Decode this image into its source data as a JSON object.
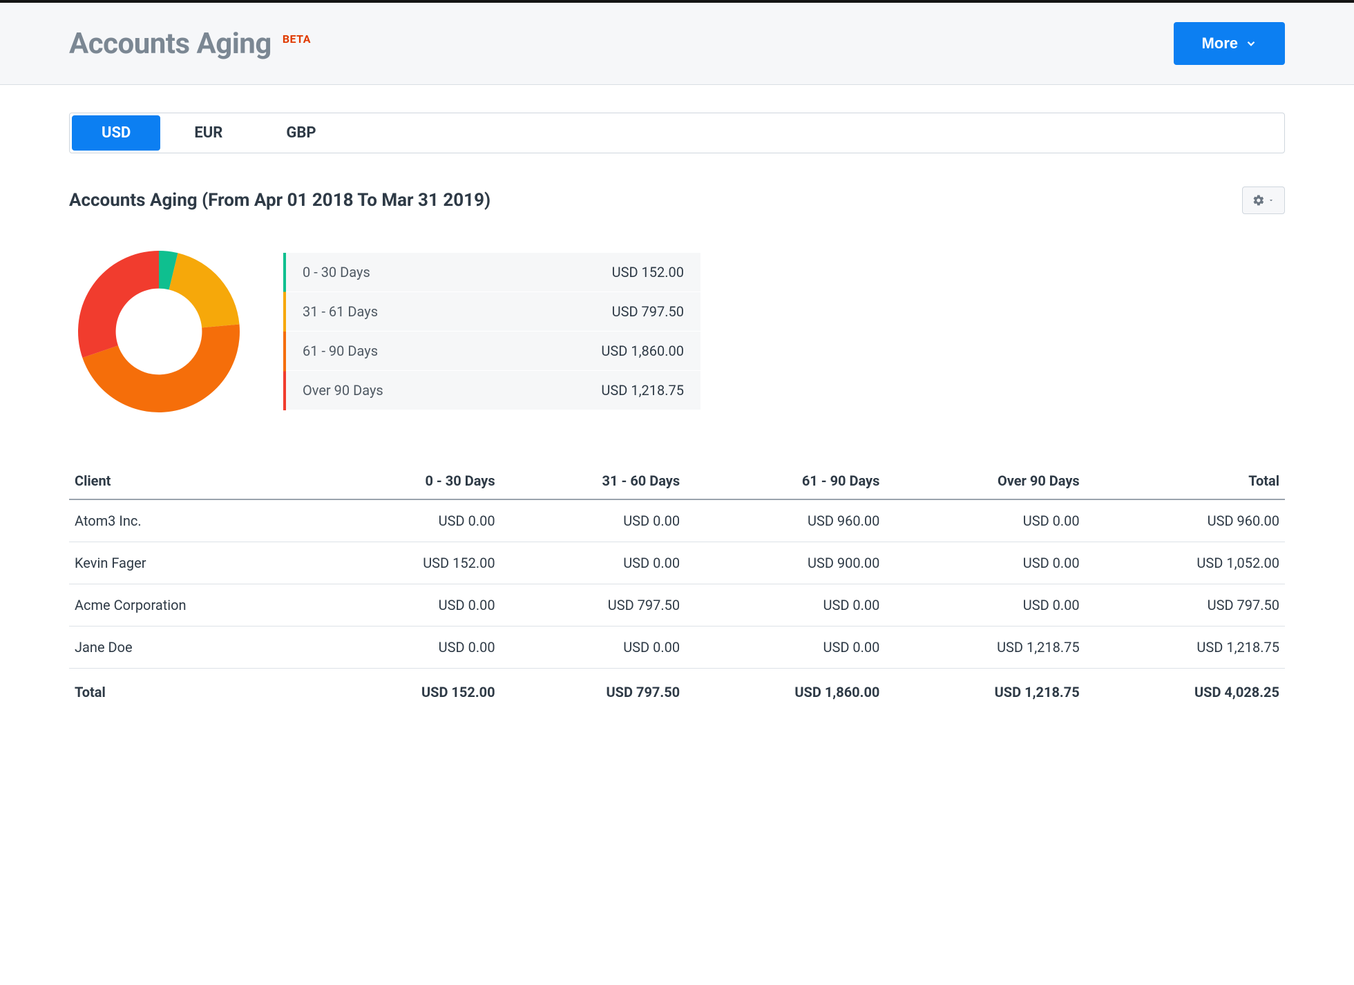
{
  "header": {
    "title": "Accounts Aging",
    "badge": "BETA",
    "more_label": "More"
  },
  "tabs": [
    {
      "label": "USD",
      "active": true
    },
    {
      "label": "EUR",
      "active": false
    },
    {
      "label": "GBP",
      "active": false
    }
  ],
  "report": {
    "title": "Accounts Aging (From Apr 01 2018 To Mar 31 2019)"
  },
  "chart_data": {
    "type": "pie",
    "title": "Accounts Aging",
    "series": [
      {
        "name": "0 - 30 Days",
        "value": 152.0,
        "value_label": "USD 152.00",
        "color": "#0fbf8f"
      },
      {
        "name": "31 - 61 Days",
        "value": 797.5,
        "value_label": "USD 797.50",
        "color": "#f6a80a"
      },
      {
        "name": "61 - 90 Days",
        "value": 1860.0,
        "value_label": "USD 1,860.00",
        "color": "#f56e0a"
      },
      {
        "name": "Over 90 Days",
        "value": 1218.75,
        "value_label": "USD 1,218.75",
        "color": "#f13c2e"
      }
    ]
  },
  "table": {
    "columns": [
      "Client",
      "0 - 30 Days",
      "31 - 60 Days",
      "61 - 90 Days",
      "Over 90 Days",
      "Total"
    ],
    "rows": [
      {
        "client": "Atom3 Inc.",
        "c0": "USD 0.00",
        "c1": "USD 0.00",
        "c2": "USD 960.00",
        "c3": "USD 0.00",
        "total": "USD 960.00"
      },
      {
        "client": "Kevin Fager",
        "c0": "USD 152.00",
        "c1": "USD 0.00",
        "c2": "USD 900.00",
        "c3": "USD 0.00",
        "total": "USD 1,052.00"
      },
      {
        "client": "Acme Corporation",
        "c0": "USD 0.00",
        "c1": "USD 797.50",
        "c2": "USD 0.00",
        "c3": "USD 0.00",
        "total": "USD 797.50"
      },
      {
        "client": "Jane Doe",
        "c0": "USD 0.00",
        "c1": "USD 0.00",
        "c2": "USD 0.00",
        "c3": "USD 1,218.75",
        "total": "USD 1,218.75"
      }
    ],
    "totals": {
      "label": "Total",
      "c0": "USD 152.00",
      "c1": "USD 797.50",
      "c2": "USD 1,860.00",
      "c3": "USD 1,218.75",
      "total": "USD 4,028.25"
    }
  }
}
